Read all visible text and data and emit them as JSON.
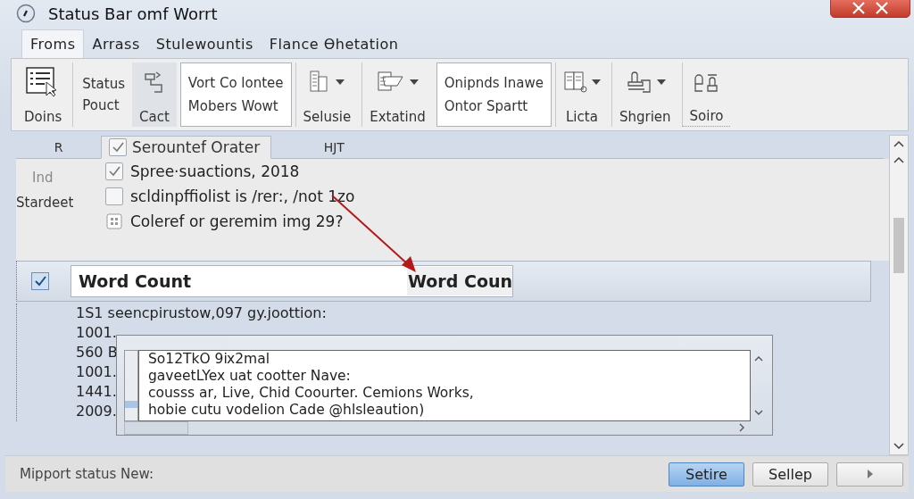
{
  "window": {
    "title": "Status Bar omf Worrt"
  },
  "menu_tabs": [
    {
      "label": "Froms",
      "selected": true
    },
    {
      "label": "Arrass",
      "selected": false
    },
    {
      "label": "Stulewountis",
      "selected": false
    },
    {
      "label": "Flance Ɵhetation",
      "selected": false
    }
  ],
  "ribbon": [
    {
      "kind": "big",
      "label": "Doins"
    },
    {
      "kind": "stack",
      "lines": [
        "Status",
        "Pouct"
      ]
    },
    {
      "kind": "big",
      "label": "Cact"
    },
    {
      "kind": "box",
      "lines": [
        "Vort  Co lontee",
        "Mobers Wowt"
      ]
    },
    {
      "kind": "drop",
      "label": "Selusie"
    },
    {
      "kind": "drop",
      "label": "Extatind"
    },
    {
      "kind": "box",
      "lines": [
        "Onipnds Inawe",
        "Ontor Spartt"
      ]
    },
    {
      "kind": "drop",
      "label": "Licta"
    },
    {
      "kind": "drop",
      "label": "Shgrien"
    },
    {
      "kind": "big",
      "label": "Soiro"
    }
  ],
  "sub_tabs": [
    {
      "label": "R",
      "selected": false
    },
    {
      "label": "Serountef Orater",
      "checked": true,
      "selected": true
    },
    {
      "label": "HJT",
      "selected": false
    }
  ],
  "side_labels": [
    "Ind",
    "Stardeet"
  ],
  "options": [
    {
      "kind": "check",
      "label": "Spree·suactions, 2018",
      "checked": true
    },
    {
      "kind": "check",
      "label": "scldinpffiolist is /rer:, /not 1zo",
      "checked": false
    },
    {
      "kind": "grid",
      "label": "Coleref or geremim img 29?"
    }
  ],
  "word_count": {
    "checked": true,
    "value": "Word Count",
    "value_2": "Word Coun"
  },
  "lines": [
    "1S1 seencpirustow,097 gy.joottion:",
    "1001.",
    "560 B",
    "1001.",
    "1441.",
    "2009."
  ],
  "popup": {
    "lines": [
      "So12TkO 9ⅸ2mal",
      "gaveetLYex uat cootter Nave:",
      "cousss ar, Live, Chid Coourter. Cemions Works,",
      "hobie cutu vodelion Cade @hlsleaution)"
    ]
  },
  "status_bar": {
    "text": "Mipport status New:",
    "buttons": [
      {
        "label": "Setire",
        "kind": "primary"
      },
      {
        "label": "Sellep",
        "kind": "normal"
      }
    ]
  }
}
